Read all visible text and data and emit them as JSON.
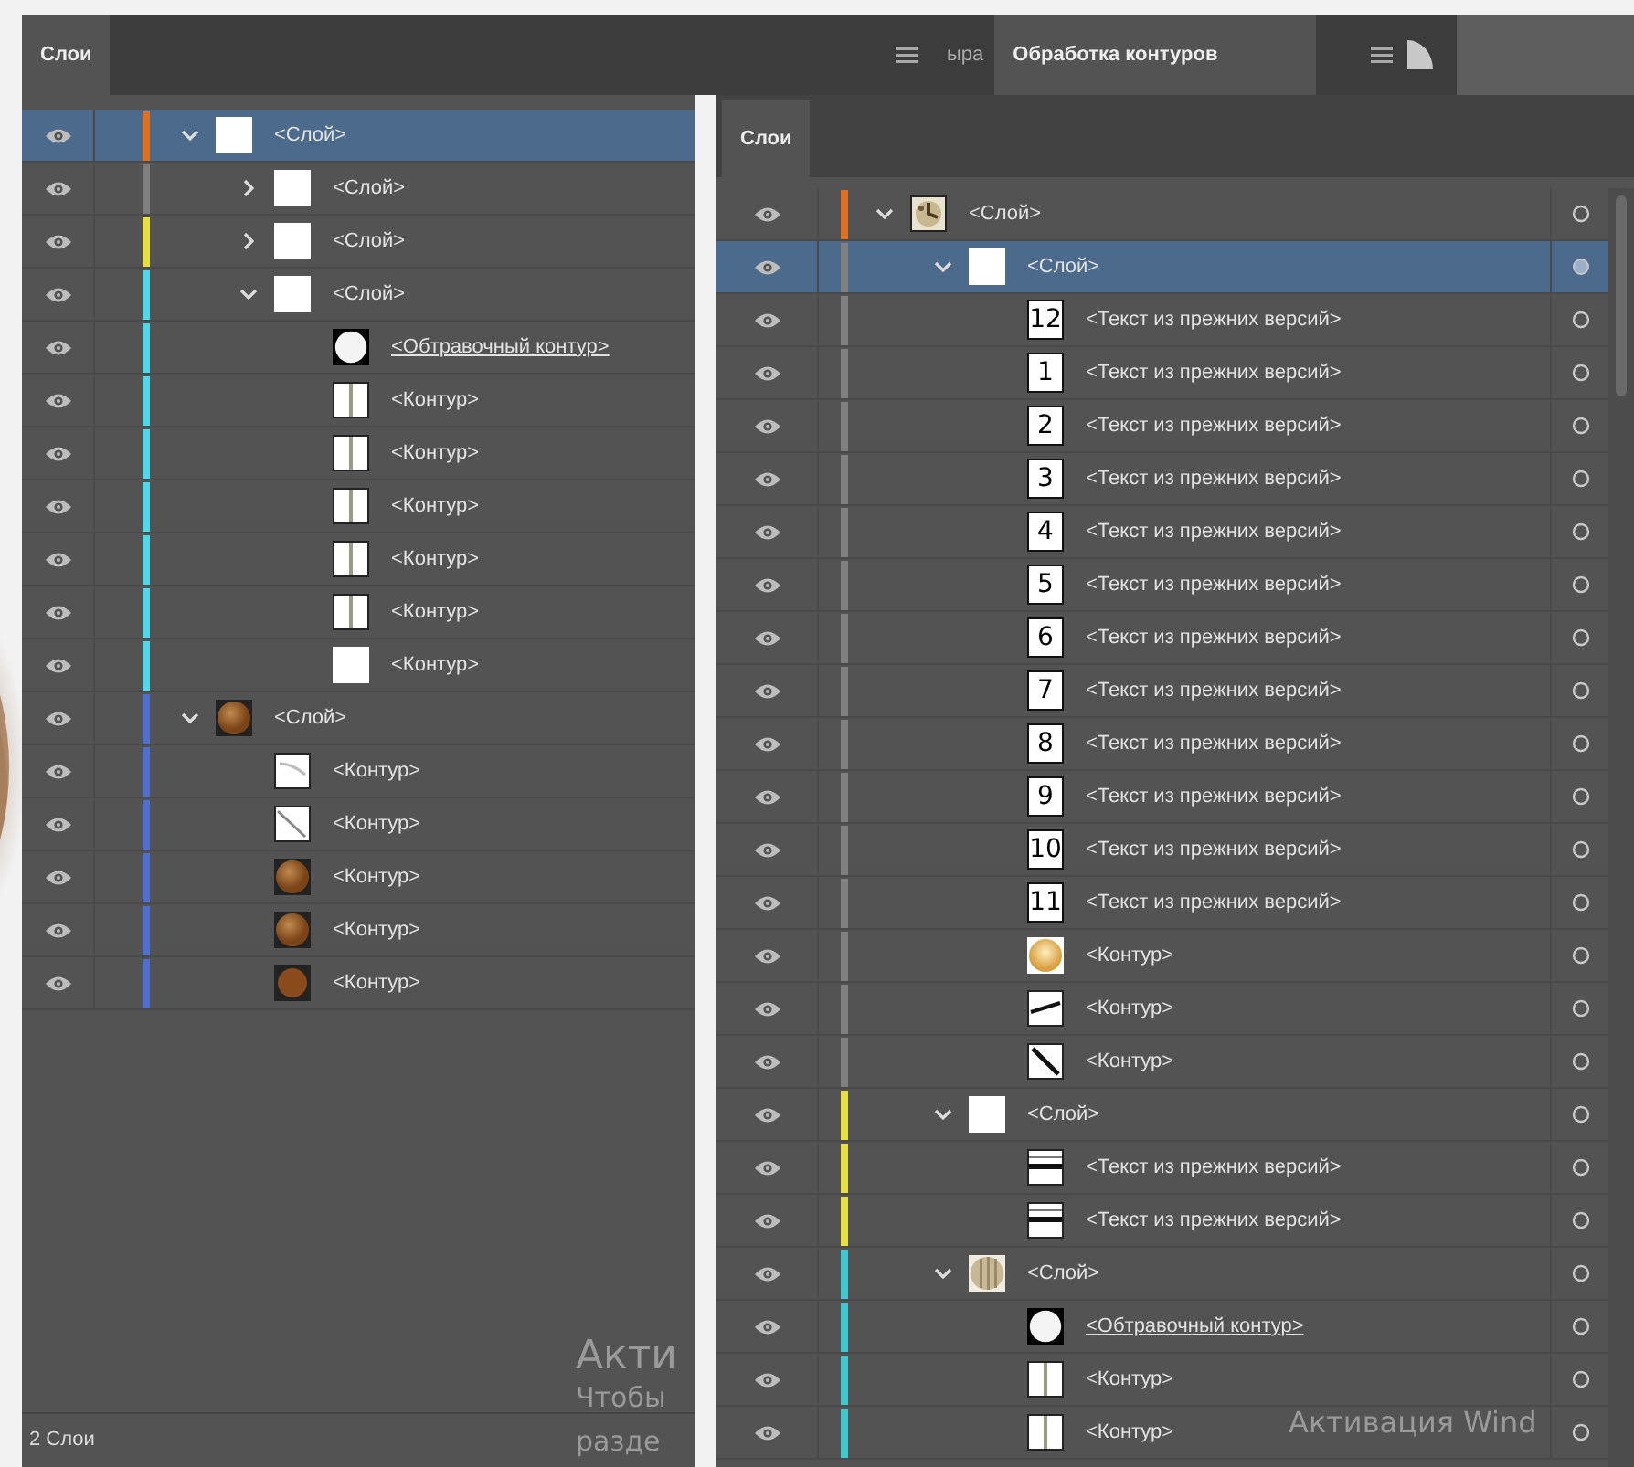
{
  "tab_groups": [
    {
      "tabs": [
        {
          "label": "Слои",
          "selected": true
        }
      ]
    },
    {
      "tabs": [
        {
          "label": "ыра",
          "selected": false
        },
        {
          "label": "Обработка контуров",
          "selected": true
        }
      ]
    }
  ],
  "left_panel": {
    "layers": [
      {
        "name": "<Слой>",
        "kind": "layer",
        "color": "#e07020",
        "expanded": true,
        "selected": true,
        "visible": true,
        "thumbnail": {
          "kind": "blank"
        },
        "children": [
          {
            "name": "<Слой>",
            "kind": "layer",
            "color": "#808080",
            "expanded": false,
            "selected": false,
            "visible": true,
            "thumbnail": {
              "kind": "blank"
            }
          },
          {
            "name": "<Слой>",
            "kind": "layer",
            "color": "#e8e040",
            "expanded": false,
            "selected": false,
            "visible": true,
            "thumbnail": {
              "kind": "blank"
            }
          },
          {
            "name": "<Слой>",
            "kind": "layer",
            "color": "#50d8e8",
            "expanded": true,
            "selected": false,
            "visible": true,
            "thumbnail": {
              "kind": "blank"
            },
            "children": [
              {
                "name": "<Обтравочный контур>",
                "kind": "clip",
                "selected": false,
                "visible": true,
                "thumbnail": {
                  "kind": "clip"
                }
              },
              {
                "name": "<Контур>",
                "kind": "path",
                "selected": false,
                "visible": true,
                "thumbnail": {
                  "kind": "stripe"
                }
              },
              {
                "name": "<Контур>",
                "kind": "path",
                "selected": false,
                "visible": true,
                "thumbnail": {
                  "kind": "stripe"
                }
              },
              {
                "name": "<Контур>",
                "kind": "path",
                "selected": false,
                "visible": true,
                "thumbnail": {
                  "kind": "stripe"
                }
              },
              {
                "name": "<Контур>",
                "kind": "path",
                "selected": false,
                "visible": true,
                "thumbnail": {
                  "kind": "stripe"
                }
              },
              {
                "name": "<Контур>",
                "kind": "path",
                "selected": false,
                "visible": true,
                "thumbnail": {
                  "kind": "stripe"
                }
              },
              {
                "name": "<Контур>",
                "kind": "path",
                "selected": false,
                "visible": true,
                "thumbnail": {
                  "kind": "blank"
                }
              }
            ]
          }
        ]
      },
      {
        "name": "<Слой>",
        "kind": "layer",
        "color": "#5070d0",
        "expanded": true,
        "selected": false,
        "visible": true,
        "thumbnail": {
          "kind": "ball"
        },
        "children": [
          {
            "name": "<Контур>",
            "kind": "path",
            "selected": false,
            "visible": true,
            "thumbnail": {
              "kind": "stroke-light"
            }
          },
          {
            "name": "<Контур>",
            "kind": "path",
            "selected": false,
            "visible": true,
            "thumbnail": {
              "kind": "stroke-diagonal"
            }
          },
          {
            "name": "<Контур>",
            "kind": "path",
            "selected": false,
            "visible": true,
            "thumbnail": {
              "kind": "ball"
            }
          },
          {
            "name": "<Контур>",
            "kind": "path",
            "selected": false,
            "visible": true,
            "thumbnail": {
              "kind": "ball"
            }
          },
          {
            "name": "<Контур>",
            "kind": "path",
            "selected": false,
            "visible": true,
            "thumbnail": {
              "kind": "ball-dark"
            }
          }
        ]
      }
    ],
    "footer": "2 Слои",
    "watermark": [
      "Акти",
      "Чтобы",
      "разде"
    ]
  },
  "right_panel": {
    "tab": {
      "label": "Слои",
      "selected": true
    },
    "layers": [
      {
        "name": "<Слой>",
        "kind": "layer",
        "color": "#e07020",
        "expanded": true,
        "selected": false,
        "visible": true,
        "thumbnail": {
          "kind": "clock"
        },
        "children": [
          {
            "name": "<Слой>",
            "kind": "layer",
            "color": "#808080",
            "expanded": true,
            "selected": true,
            "visible": true,
            "thumbnail": {
              "kind": "blank"
            },
            "children": [
              {
                "name": "<Текст из прежних версий>",
                "kind": "text",
                "selected": false,
                "visible": true,
                "thumbnail": {
                  "kind": "number",
                  "text": "12"
                }
              },
              {
                "name": "<Текст из прежних версий>",
                "kind": "text",
                "selected": false,
                "visible": true,
                "thumbnail": {
                  "kind": "number",
                  "text": "1"
                }
              },
              {
                "name": "<Текст из прежних версий>",
                "kind": "text",
                "selected": false,
                "visible": true,
                "thumbnail": {
                  "kind": "number",
                  "text": "2"
                }
              },
              {
                "name": "<Текст из прежних версий>",
                "kind": "text",
                "selected": false,
                "visible": true,
                "thumbnail": {
                  "kind": "number",
                  "text": "3"
                }
              },
              {
                "name": "<Текст из прежних версий>",
                "kind": "text",
                "selected": false,
                "visible": true,
                "thumbnail": {
                  "kind": "number",
                  "text": "4"
                }
              },
              {
                "name": "<Текст из прежних версий>",
                "kind": "text",
                "selected": false,
                "visible": true,
                "thumbnail": {
                  "kind": "number",
                  "text": "5"
                }
              },
              {
                "name": "<Текст из прежних версий>",
                "kind": "text",
                "selected": false,
                "visible": true,
                "thumbnail": {
                  "kind": "number",
                  "text": "6"
                }
              },
              {
                "name": "<Текст из прежних версий>",
                "kind": "text",
                "selected": false,
                "visible": true,
                "thumbnail": {
                  "kind": "number",
                  "text": "7"
                }
              },
              {
                "name": "<Текст из прежних версий>",
                "kind": "text",
                "selected": false,
                "visible": true,
                "thumbnail": {
                  "kind": "number",
                  "text": "8"
                }
              },
              {
                "name": "<Текст из прежних версий>",
                "kind": "text",
                "selected": false,
                "visible": true,
                "thumbnail": {
                  "kind": "number",
                  "text": "9"
                }
              },
              {
                "name": "<Текст из прежних версий>",
                "kind": "text",
                "selected": false,
                "visible": true,
                "thumbnail": {
                  "kind": "number",
                  "text": "10"
                }
              },
              {
                "name": "<Текст из прежних версий>",
                "kind": "text",
                "selected": false,
                "visible": true,
                "thumbnail": {
                  "kind": "number",
                  "text": "11"
                }
              },
              {
                "name": "<Контур>",
                "kind": "path",
                "selected": false,
                "visible": true,
                "thumbnail": {
                  "kind": "ball-light"
                }
              },
              {
                "name": "<Контур>",
                "kind": "path",
                "selected": false,
                "visible": true,
                "thumbnail": {
                  "kind": "stroke-flat"
                }
              },
              {
                "name": "<Контур>",
                "kind": "path",
                "selected": false,
                "visible": true,
                "thumbnail": {
                  "kind": "brush"
                }
              }
            ]
          },
          {
            "name": "<Слой>",
            "kind": "layer",
            "color": "#e8e040",
            "expanded": true,
            "selected": false,
            "visible": true,
            "thumbnail": {
              "kind": "blank"
            },
            "children": [
              {
                "name": "<Текст из прежних версий>",
                "kind": "text",
                "selected": false,
                "visible": true,
                "thumbnail": {
                  "kind": "text-lines"
                }
              },
              {
                "name": "<Текст из прежних версий>",
                "kind": "text",
                "selected": false,
                "visible": true,
                "thumbnail": {
                  "kind": "text-lines"
                }
              }
            ]
          },
          {
            "name": "<Слой>",
            "kind": "layer",
            "color": "#40c8d0",
            "expanded": true,
            "selected": false,
            "visible": true,
            "thumbnail": {
              "kind": "stripe-ball"
            },
            "children": [
              {
                "name": "<Обтравочный контур>",
                "kind": "clip",
                "selected": false,
                "visible": true,
                "thumbnail": {
                  "kind": "clip"
                }
              },
              {
                "name": "<Контур>",
                "kind": "path",
                "selected": false,
                "visible": true,
                "thumbnail": {
                  "kind": "stripe"
                }
              },
              {
                "name": "<Контур>",
                "kind": "path",
                "selected": false,
                "visible": true,
                "thumbnail": {
                  "kind": "stripe"
                }
              }
            ]
          }
        ]
      }
    ],
    "watermark": [
      "Активация Wind"
    ]
  }
}
